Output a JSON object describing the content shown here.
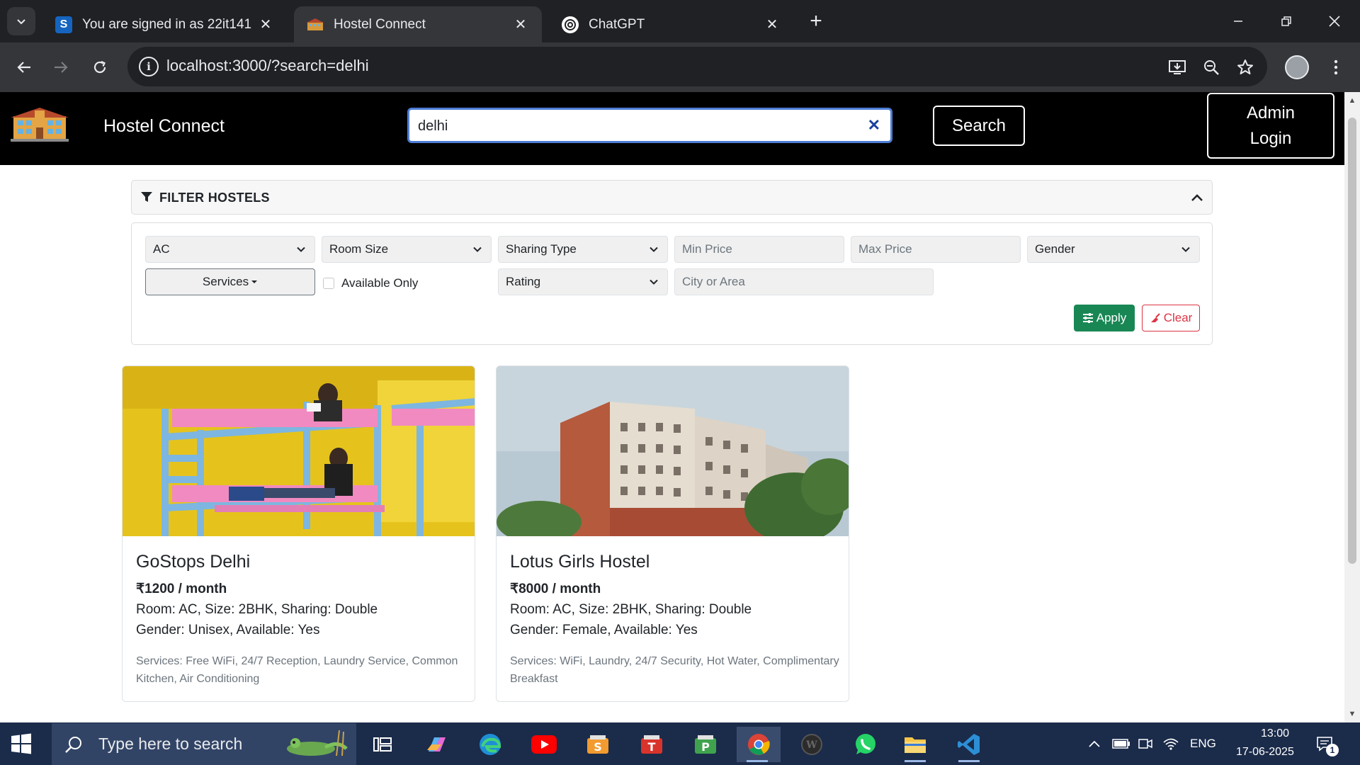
{
  "browser": {
    "tabs": [
      {
        "title": "You are signed in as 22it141",
        "favicon": "s-badge-icon"
      },
      {
        "title": "Hostel Connect",
        "favicon": "hostel-icon"
      },
      {
        "title": "ChatGPT",
        "favicon": "chatgpt-icon"
      }
    ],
    "url": "localhost:3000/?search=delhi"
  },
  "navbar": {
    "brand": "Hostel Connect",
    "search_value": "delhi",
    "search_button": "Search",
    "admin_button": "Admin Login"
  },
  "filters": {
    "header": "FILTER HOSTELS",
    "ac": "AC",
    "room_size": "Room Size",
    "sharing_type": "Sharing Type",
    "min_price_placeholder": "Min Price",
    "max_price_placeholder": "Max Price",
    "gender": "Gender",
    "services": "Services",
    "available_only": "Available Only",
    "rating": "Rating",
    "city_placeholder": "City or Area",
    "apply": "Apply",
    "clear": "Clear"
  },
  "hostels": [
    {
      "name": "GoStops Delhi",
      "price": "₹1200 / month",
      "room": "Room: AC, Size: 2BHK, Sharing: Double",
      "gender": "Gender: Unisex, Available: Yes",
      "services": "Services: Free WiFi, 24/7 Reception, Laundry Service, Common Kitchen, Air Conditioning"
    },
    {
      "name": "Lotus Girls Hostel",
      "price": "₹8000 / month",
      "room": "Room: AC, Size: 2BHK, Sharing: Double",
      "gender": "Gender: Female, Available: Yes",
      "services": "Services: WiFi, Laundry, 24/7 Security, Hot Water, Complimentary Breakfast"
    }
  ],
  "taskbar": {
    "search_placeholder": "Type here to search",
    "language": "ENG",
    "time": "13:00",
    "date": "17-06-2025",
    "notification_count": "1"
  },
  "colors": {
    "apply": "#198754",
    "clear": "#dc3545",
    "focus_border": "#4d7dd6"
  }
}
